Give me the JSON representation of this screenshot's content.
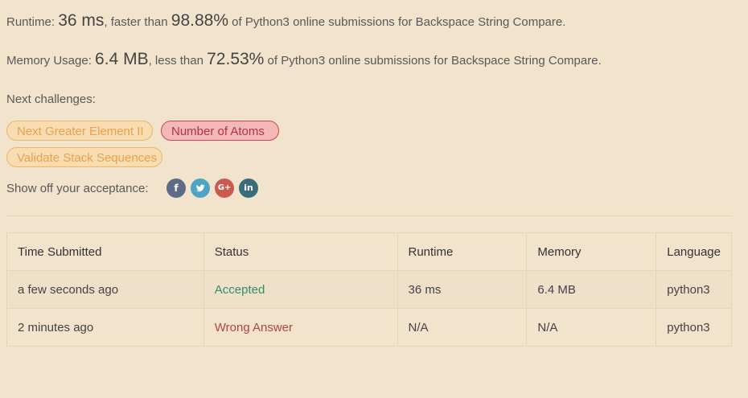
{
  "result": {
    "runtime_label": "Runtime: ",
    "runtime_value": "36 ms",
    "runtime_mid": ", faster than ",
    "runtime_percent": "98.88%",
    "runtime_suffix": " of Python3 online submissions for Backspace String Compare.",
    "memory_label": "Memory Usage: ",
    "memory_value": "6.4 MB",
    "memory_mid": ", less than ",
    "memory_percent": "72.53%",
    "memory_suffix": " of Python3 online submissions for Backspace String Compare."
  },
  "next_challenges": {
    "label": "Next challenges:",
    "items": [
      {
        "label": "Next Greater Element II",
        "difficulty": "medium"
      },
      {
        "label": "Number of Atoms",
        "difficulty": "hard"
      },
      {
        "label": "Validate Stack Sequences",
        "difficulty": "medium"
      }
    ]
  },
  "share": {
    "label": "Show off your acceptance:",
    "icons": [
      "facebook-icon",
      "twitter-icon",
      "google-plus-icon",
      "linkedin-icon"
    ],
    "glyphs": {
      "facebook": "f",
      "twitter": "t",
      "google_plus": "G+",
      "linkedin": "in"
    }
  },
  "colors": {
    "background": "#f1e3cc",
    "accepted": "#2f8f6a",
    "wrong_answer": "#b3434a",
    "medium_chip": "#e9a24a",
    "hard_chip": "#b23050"
  },
  "table": {
    "headers": [
      "Time Submitted",
      "Status",
      "Runtime",
      "Memory",
      "Language"
    ],
    "rows": [
      {
        "time": "a few seconds ago",
        "status": "Accepted",
        "runtime": "36 ms",
        "memory": "6.4 MB",
        "language": "python3"
      },
      {
        "time": "2 minutes ago",
        "status": "Wrong Answer",
        "runtime": "N/A",
        "memory": "N/A",
        "language": "python3"
      }
    ]
  }
}
